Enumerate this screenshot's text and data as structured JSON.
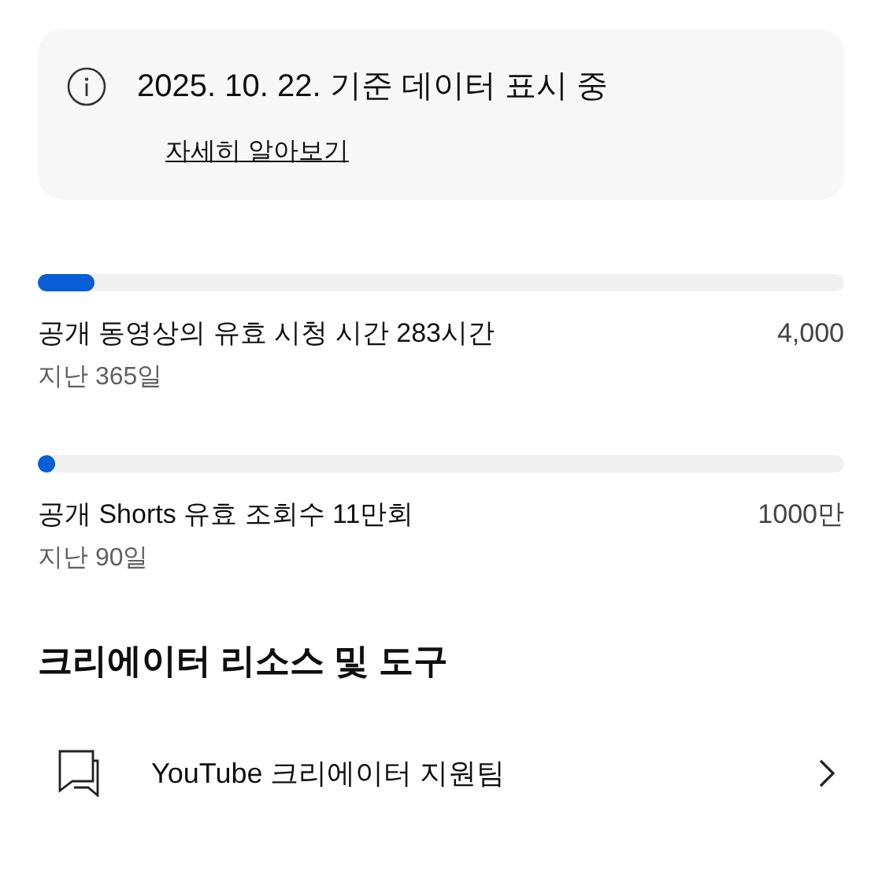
{
  "notice": {
    "title": "2025. 10. 22. 기준 데이터 표시 중",
    "link": "자세히 알아보기"
  },
  "metrics": [
    {
      "label": "공개 동영상의 유효 시청 시간 283시간",
      "period": "지난 365일",
      "target": "4,000",
      "level": 0.07
    },
    {
      "label": "공개 Shorts 유효 조회수 11만회",
      "period": "지난 90일",
      "target": "1000만",
      "level": 0.011
    }
  ],
  "section": {
    "title": "크리에이터 리소스 및 도구",
    "items": [
      {
        "label": "YouTube 크리에이터 지원팀",
        "kind": "chat"
      }
    ]
  }
}
